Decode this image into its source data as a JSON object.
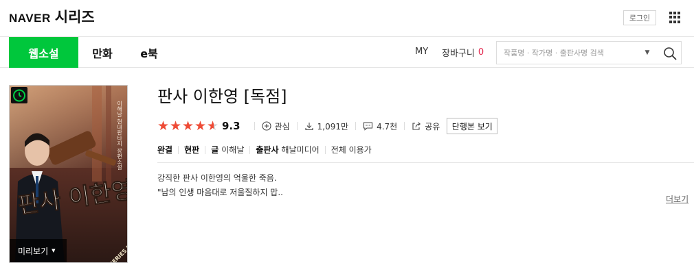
{
  "header": {
    "logo_naver": "NAVER",
    "logo_series": "시리즈",
    "login_label": "로그인"
  },
  "nav": {
    "tabs": [
      {
        "label": "웹소설",
        "active": true
      },
      {
        "label": "만화",
        "active": false
      },
      {
        "label": "e북",
        "active": false
      }
    ],
    "my_label": "MY",
    "cart_label": "장바구니",
    "cart_count": "0",
    "search_placeholder": "작품명 · 작가명 · 출판사명 검색"
  },
  "book": {
    "cover_title_text": "판사 이한영",
    "cover_author_text": "이해날 현대판타지 장편소설",
    "cover_edition_text": "SERIES EDITION",
    "preview_label": "미리보기",
    "title": "판사 이한영 [독점]",
    "rating": "9.3",
    "rating_value": 4.6,
    "interest_label": "관심",
    "downloads": "1,091만",
    "comments": "4.7천",
    "share_label": "공유",
    "volume_button": "단행본 보기",
    "status": "완결",
    "edition": "현판",
    "author_label": "글",
    "author": "이해날",
    "publisher_label": "출판사",
    "publisher": "해날미디어",
    "age_rating": "전체 이용가",
    "synopsis": [
      "강직한 판사 이한영의 억울한 죽음.",
      "\"남의 인생 마음대로 저울질하지 맙.."
    ],
    "more_label": "더보기"
  },
  "colors": {
    "accent_green": "#00c73c",
    "star_red": "#ee4b36",
    "cart_count_red": "#e3254c"
  }
}
